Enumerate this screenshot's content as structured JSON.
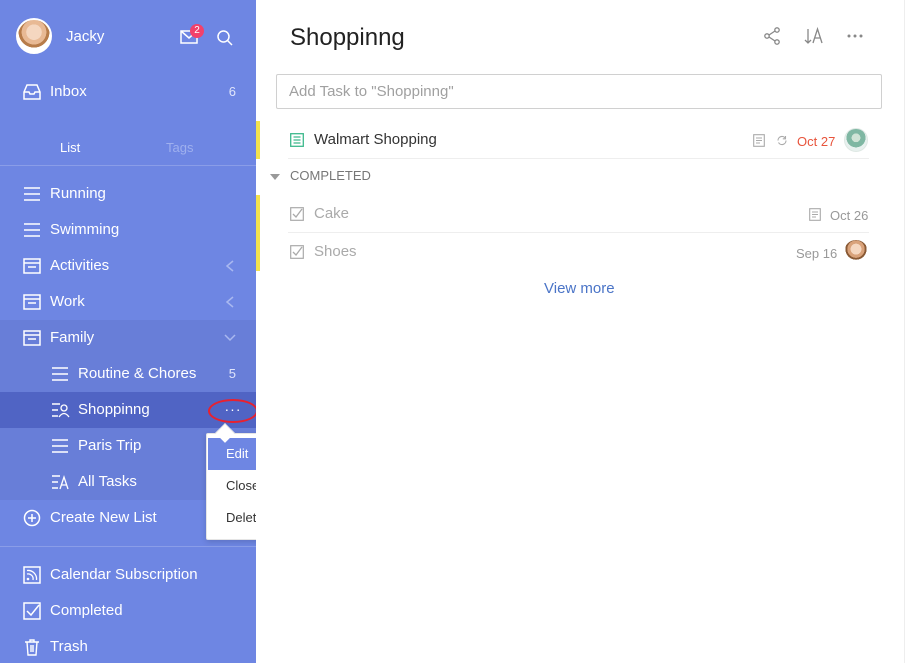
{
  "user": {
    "name": "Jacky",
    "mail_badge": "2"
  },
  "sidebar": {
    "inbox": {
      "label": "Inbox",
      "count": "6"
    },
    "tabs": {
      "list": "List",
      "tags": "Tags"
    },
    "lists": [
      {
        "label": "Running"
      },
      {
        "label": "Swimming"
      },
      {
        "label": "Activities"
      },
      {
        "label": "Work"
      },
      {
        "label": "Family"
      }
    ],
    "family_children": [
      {
        "label": "Routine & Chores",
        "count": "5"
      },
      {
        "label": "Shoppinng"
      },
      {
        "label": "Paris Trip"
      },
      {
        "label": "All Tasks"
      }
    ],
    "create_new": "Create New List",
    "bottom": [
      {
        "label": "Calendar Subscription"
      },
      {
        "label": "Completed"
      },
      {
        "label": "Trash"
      }
    ],
    "more_glyph": "···"
  },
  "popup_menu": {
    "items": [
      "Edit",
      "Close",
      "Delete"
    ],
    "highlighted": "Edit"
  },
  "main": {
    "title": "Shoppinng",
    "add_placeholder": "Add Task to \"Shoppinng\"",
    "tasks": [
      {
        "name": "Walmart Shopping",
        "date": "Oct 27",
        "date_color": "#e8543c"
      }
    ],
    "completed_label": "COMPLETED",
    "completed_tasks": [
      {
        "name": "Cake",
        "date": "Oct 26"
      },
      {
        "name": "Shoes",
        "date": "Sep 16"
      }
    ],
    "view_more": "View more"
  },
  "colors": {
    "sidebar_bg": "#6e86e3",
    "active_bg": "#5064c4",
    "accent": "#6e86e3",
    "badge": "#f2416b",
    "priority_marker": "#f3e24d",
    "due_date": "#e8543c",
    "link": "#4a74c7"
  }
}
